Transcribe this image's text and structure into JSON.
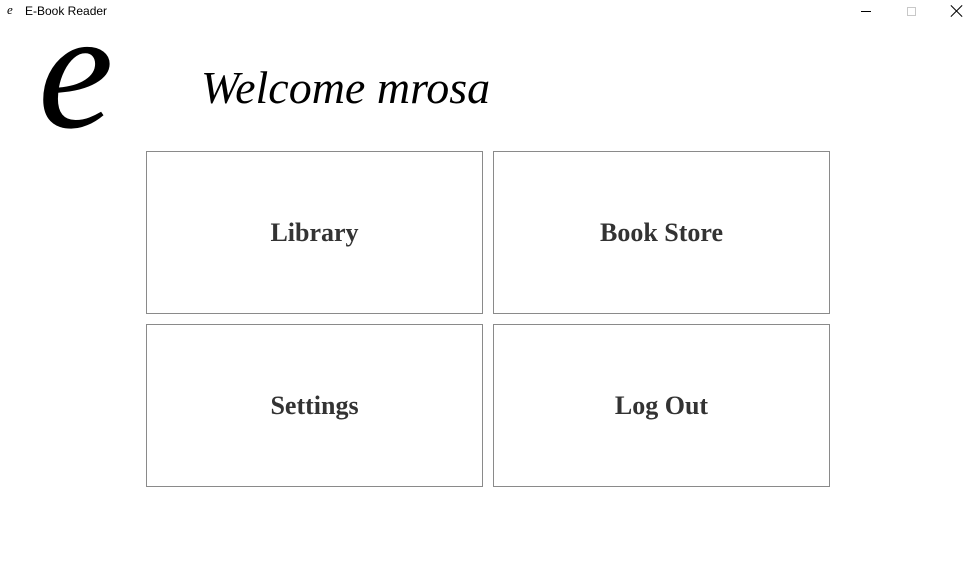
{
  "window": {
    "title": "E-Book Reader",
    "icon_glyph": "e"
  },
  "logo": {
    "glyph": "e"
  },
  "header": {
    "welcome_text": "Welcome mrosa"
  },
  "menu": {
    "library_label": "Library",
    "book_store_label": "Book Store",
    "settings_label": "Settings",
    "log_out_label": "Log Out"
  },
  "colors": {
    "tile_border": "#8a8a8a",
    "tile_text": "#333333",
    "background": "#ffffff"
  }
}
